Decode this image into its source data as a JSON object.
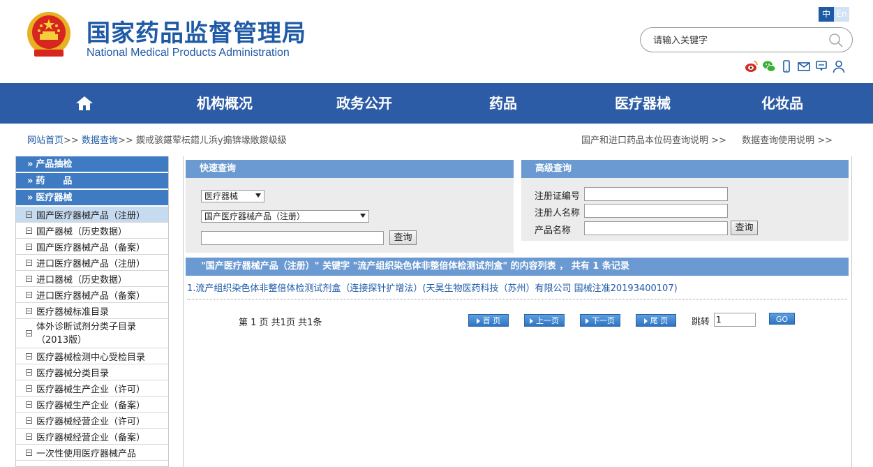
{
  "header": {
    "title_cn": "国家药品监督管理局",
    "title_en": "National Medical Products Administration",
    "lang_zh": "中",
    "lang_en": "En",
    "search_placeholder": "请输入关键字"
  },
  "nav": {
    "items": [
      "机构概况",
      "政务公开",
      "药品",
      "医疗器械",
      "化妆品"
    ]
  },
  "breadcrumb": {
    "home": "网站首页",
    "sep": ">>",
    "data_query": "数据查询",
    "current": "鍥戒骇鍖荤枟鍣ㄦ浜у搧锛堟敞鍐岋級",
    "right_1": "国产和进口药品本位码查询说明 >>",
    "right_2": "数据查询使用说明 >>"
  },
  "sidebar": {
    "categories": [
      "产品抽检",
      "药　　品",
      "医疗器械"
    ],
    "items": [
      "国产医疗器械产品（注册）",
      "国产器械（历史数据）",
      "国产医疗器械产品（备案）",
      "进口医疗器械产品（注册）",
      "进口器械（历史数据）",
      "进口医疗器械产品（备案）",
      "医疗器械标准目录",
      "体外诊断试剂分类子目录（2013版）",
      "医疗器械检测中心受检目录",
      "医疗器械分类目录",
      "医疗器械生产企业（许可）",
      "医疗器械生产企业（备案）",
      "医疗器械经营企业（许可）",
      "医疗器械经营企业（备案）",
      "一次性使用医疗器械产品"
    ],
    "item_7_line1": "体外诊断试剂分类子目录",
    "item_7_line2": "（2013版）"
  },
  "quick": {
    "title": "快速查询",
    "select_1": "医疗器械",
    "select_2": "国产医疗器械产品（注册）",
    "keyword": "",
    "button": "查询"
  },
  "advanced": {
    "title": "高级查询",
    "label_1": "注册证编号",
    "label_2": "注册人名称",
    "label_3": "产品名称",
    "button": "查询"
  },
  "result": {
    "header": "\"国产医疗器械产品（注册）\" 关键字 \"流产组织染色体非整倍体检测试剂盒\" 的内容列表 ， 共有 1 条记录",
    "line": "1.流产组织染色体非整倍体检测试剂盒（连接探针扩增法）(天昊生物医药科技（苏州）有限公司 国械注准20193400107)"
  },
  "pager": {
    "text": "第 1 页 共1页 共1条",
    "first": "首 页",
    "prev": "上一页",
    "next": "下一页",
    "last": "尾 页",
    "jump_label": "跳转",
    "jump_value": "1",
    "go": "GO"
  },
  "colors": {
    "brand": "#1f5aa6",
    "nav_bg": "#2d5ca6",
    "panel_head": "#6a9ad1",
    "sidebar_cat": "#3f7bc2"
  }
}
